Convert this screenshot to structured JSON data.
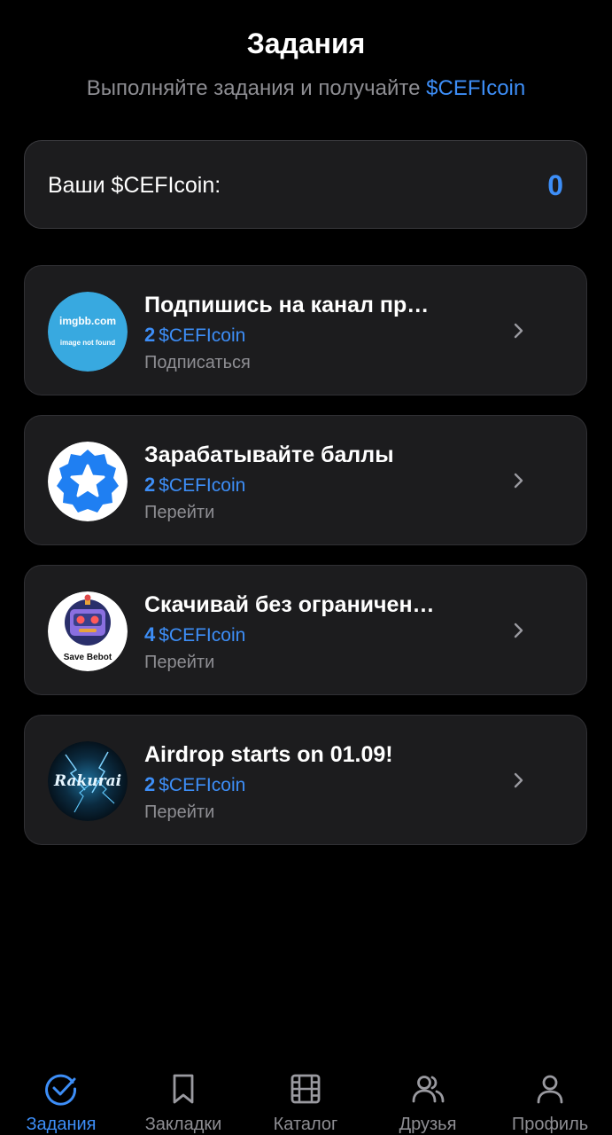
{
  "header": {
    "title": "Задания",
    "subtitle_prefix": "Выполняйте задания и получайте ",
    "subtitle_accent": "$CEFIcoin"
  },
  "balance": {
    "label": "Ваши $CEFIcoin:",
    "value": "0"
  },
  "tasks": [
    {
      "title": "Подпишись на канал пр…",
      "amount": "2",
      "currency": "$CEFIcoin",
      "action": "Подписаться",
      "avatar_line1": "imgbb.com",
      "avatar_line2": "image not found"
    },
    {
      "title": "Зарабатывайте баллы",
      "amount": "2",
      "currency": "$CEFIcoin",
      "action": "Перейти",
      "avatar_icon": "star-badge-icon"
    },
    {
      "title": "Скачивай без ограничен…",
      "amount": "4",
      "currency": "$CEFIcoin",
      "action": "Перейти",
      "avatar_text": "Save Bebot"
    },
    {
      "title": "Airdrop starts on 01.09!",
      "amount": "2",
      "currency": "$CEFIcoin",
      "action": "Перейти",
      "avatar_text": "Rakurai"
    }
  ],
  "tabbar": {
    "items": [
      {
        "label": "Задания",
        "icon": "check-circle-icon",
        "active": true
      },
      {
        "label": "Закладки",
        "icon": "bookmark-icon",
        "active": false
      },
      {
        "label": "Каталог",
        "icon": "film-icon",
        "active": false
      },
      {
        "label": "Друзья",
        "icon": "users-icon",
        "active": false
      },
      {
        "label": "Профиль",
        "icon": "user-icon",
        "active": false
      }
    ]
  },
  "colors": {
    "accent": "#3d8ef7",
    "background": "#000000",
    "card": "#1c1c1e",
    "muted": "#8e8e93"
  }
}
